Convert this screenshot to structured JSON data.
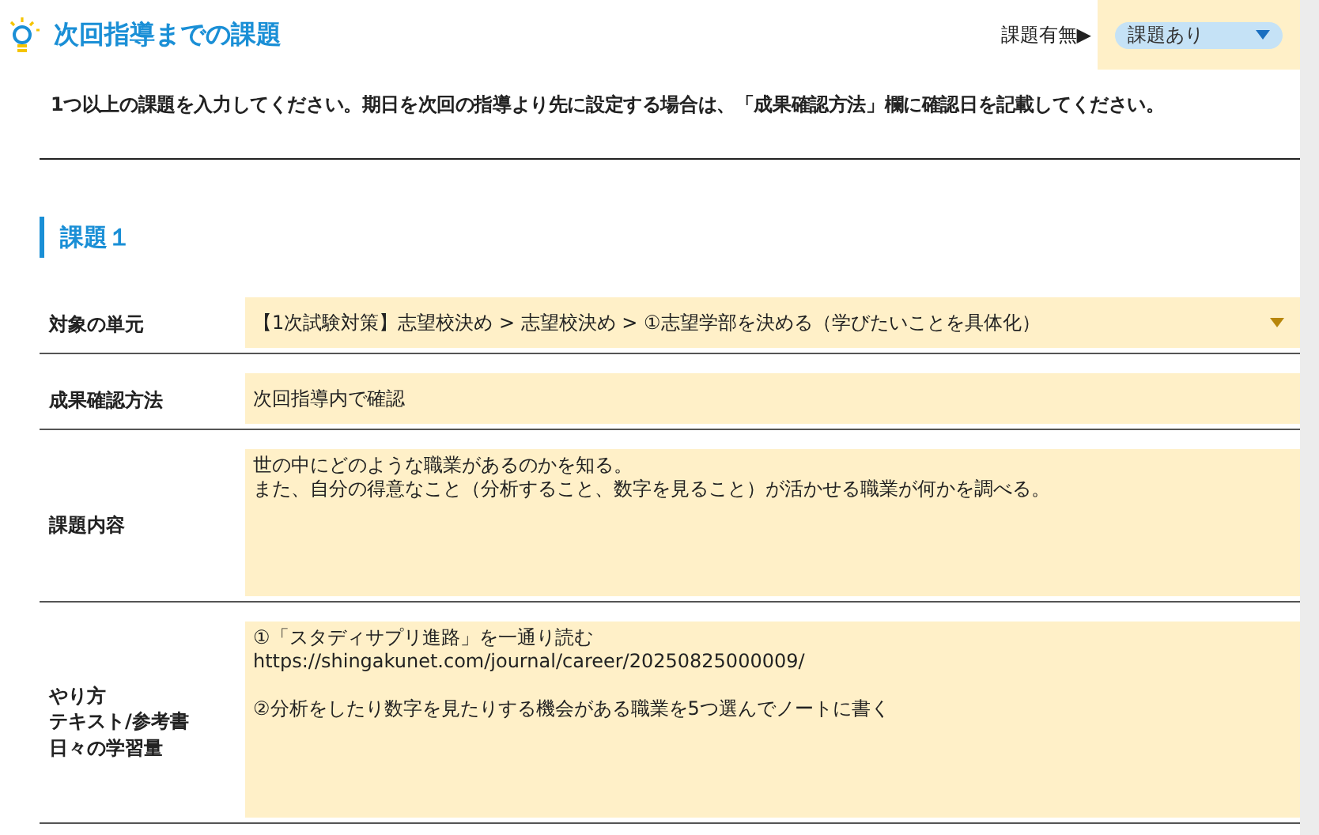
{
  "header": {
    "title": "次回指導までの課題",
    "toggle_label": "課題有無▶",
    "toggle_value": "課題あり"
  },
  "instruction": "1つ以上の課題を入力してください。期日を次回の指導より先に設定する場合は、「成果確認方法」欄に確認日を記載してください。",
  "section_title": "課題１",
  "rows": [
    {
      "kind": "select",
      "label_lines": [
        "対象の単元"
      ],
      "blocks": [
        [
          "【1次試験対策】志望校決め > 志望校決め > ①志望学部を決める（学びたいことを具体化）"
        ]
      ]
    },
    {
      "kind": "input",
      "label_lines": [
        "成果確認方法"
      ],
      "blocks": [
        [
          "次回指導内で確認"
        ]
      ]
    },
    {
      "kind": "textarea",
      "label_lines": [
        "課題内容"
      ],
      "blocks": [
        [
          "世の中にどのような職業があるのかを知る。",
          "また、自分の得意なこと（分析すること、数字を見ること）が活かせる職業が何かを調べる。"
        ]
      ]
    },
    {
      "kind": "textarea",
      "label_lines": [
        "やり方",
        "テキスト/参考書",
        "日々の学習量"
      ],
      "blocks": [
        [
          "①「スタディサプリ進路」を一通り読む",
          "https://shingakunet.com/journal/career/20250825000009/"
        ],
        [
          "②分析をしたり数字を見たりする機会がある職業を5つ選んでノートに書く"
        ]
      ]
    }
  ]
}
